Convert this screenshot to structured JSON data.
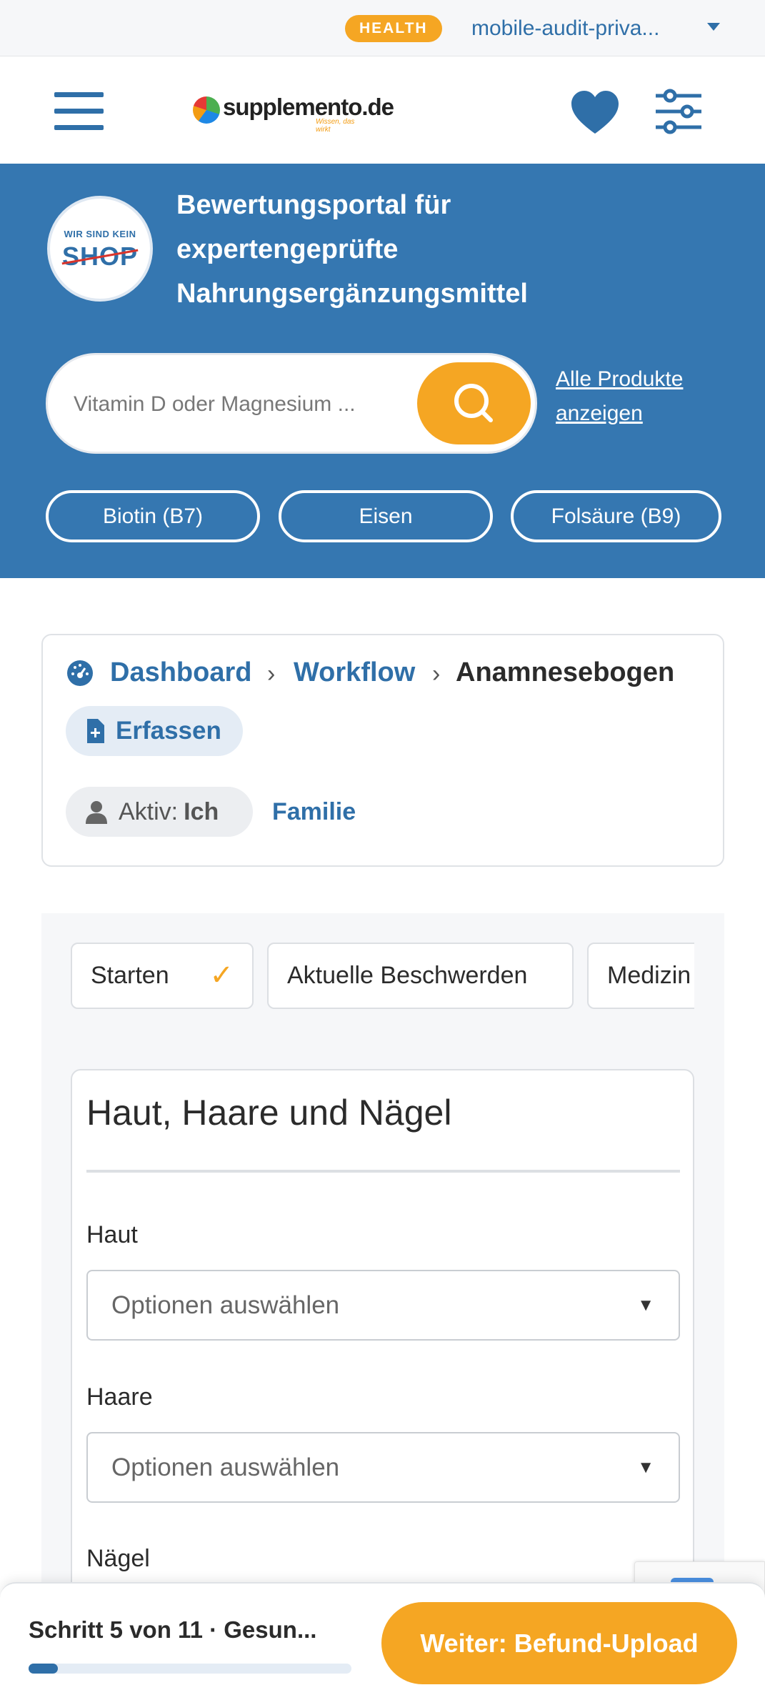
{
  "account": {
    "badge": "HEALTH",
    "name": "mobile-audit-priva..."
  },
  "header": {
    "logo_text": "supplemento.de",
    "logo_tagline": "Wissen, das wirkt",
    "icons": [
      "menu-icon",
      "heart-icon",
      "filter-sliders-icon"
    ]
  },
  "hero": {
    "badge_top": "WIR SIND KEIN",
    "badge_word": "SHOP",
    "title": "Bewertungsportal für expertengeprüfte Nahrungsergänzungsmittel",
    "search_placeholder": "Vitamin D oder Magnesium ...",
    "all_products": "Alle Produkte anzeigen",
    "chips": [
      "Biotin (B7)",
      "Eisen",
      "Folsäure (B9)"
    ]
  },
  "breadcrumb": {
    "items": [
      "Dashboard",
      "Workflow",
      "Anamnesebogen"
    ],
    "separator": "›",
    "action": "Erfassen",
    "active_label": "Aktiv:",
    "active_value": "Ich",
    "other_profile": "Familie"
  },
  "workflow": {
    "tabs": [
      {
        "label": "Starten",
        "done": true
      },
      {
        "label": "Aktuelle Beschwerden",
        "done": false
      },
      {
        "label": "Medizin",
        "done": false
      }
    ],
    "check_glyph": "✓",
    "section_title": "Haut, Haare und Nägel",
    "fields": [
      {
        "label": "Haut",
        "value": "Optionen auswählen"
      },
      {
        "label": "Haare",
        "value": "Optionen auswählen"
      },
      {
        "label": "Nägel",
        "value": ""
      }
    ],
    "select_arrow": "▼"
  },
  "footer": {
    "step_text": "Schritt 5 von 11 · Gesun...",
    "progress_fraction": 0.09,
    "next_button": "Weiter: Befund-Upload"
  },
  "colors": {
    "primary_blue": "#2f6fa8",
    "hero_blue": "#3577b1",
    "accent_orange": "#f5a623"
  }
}
